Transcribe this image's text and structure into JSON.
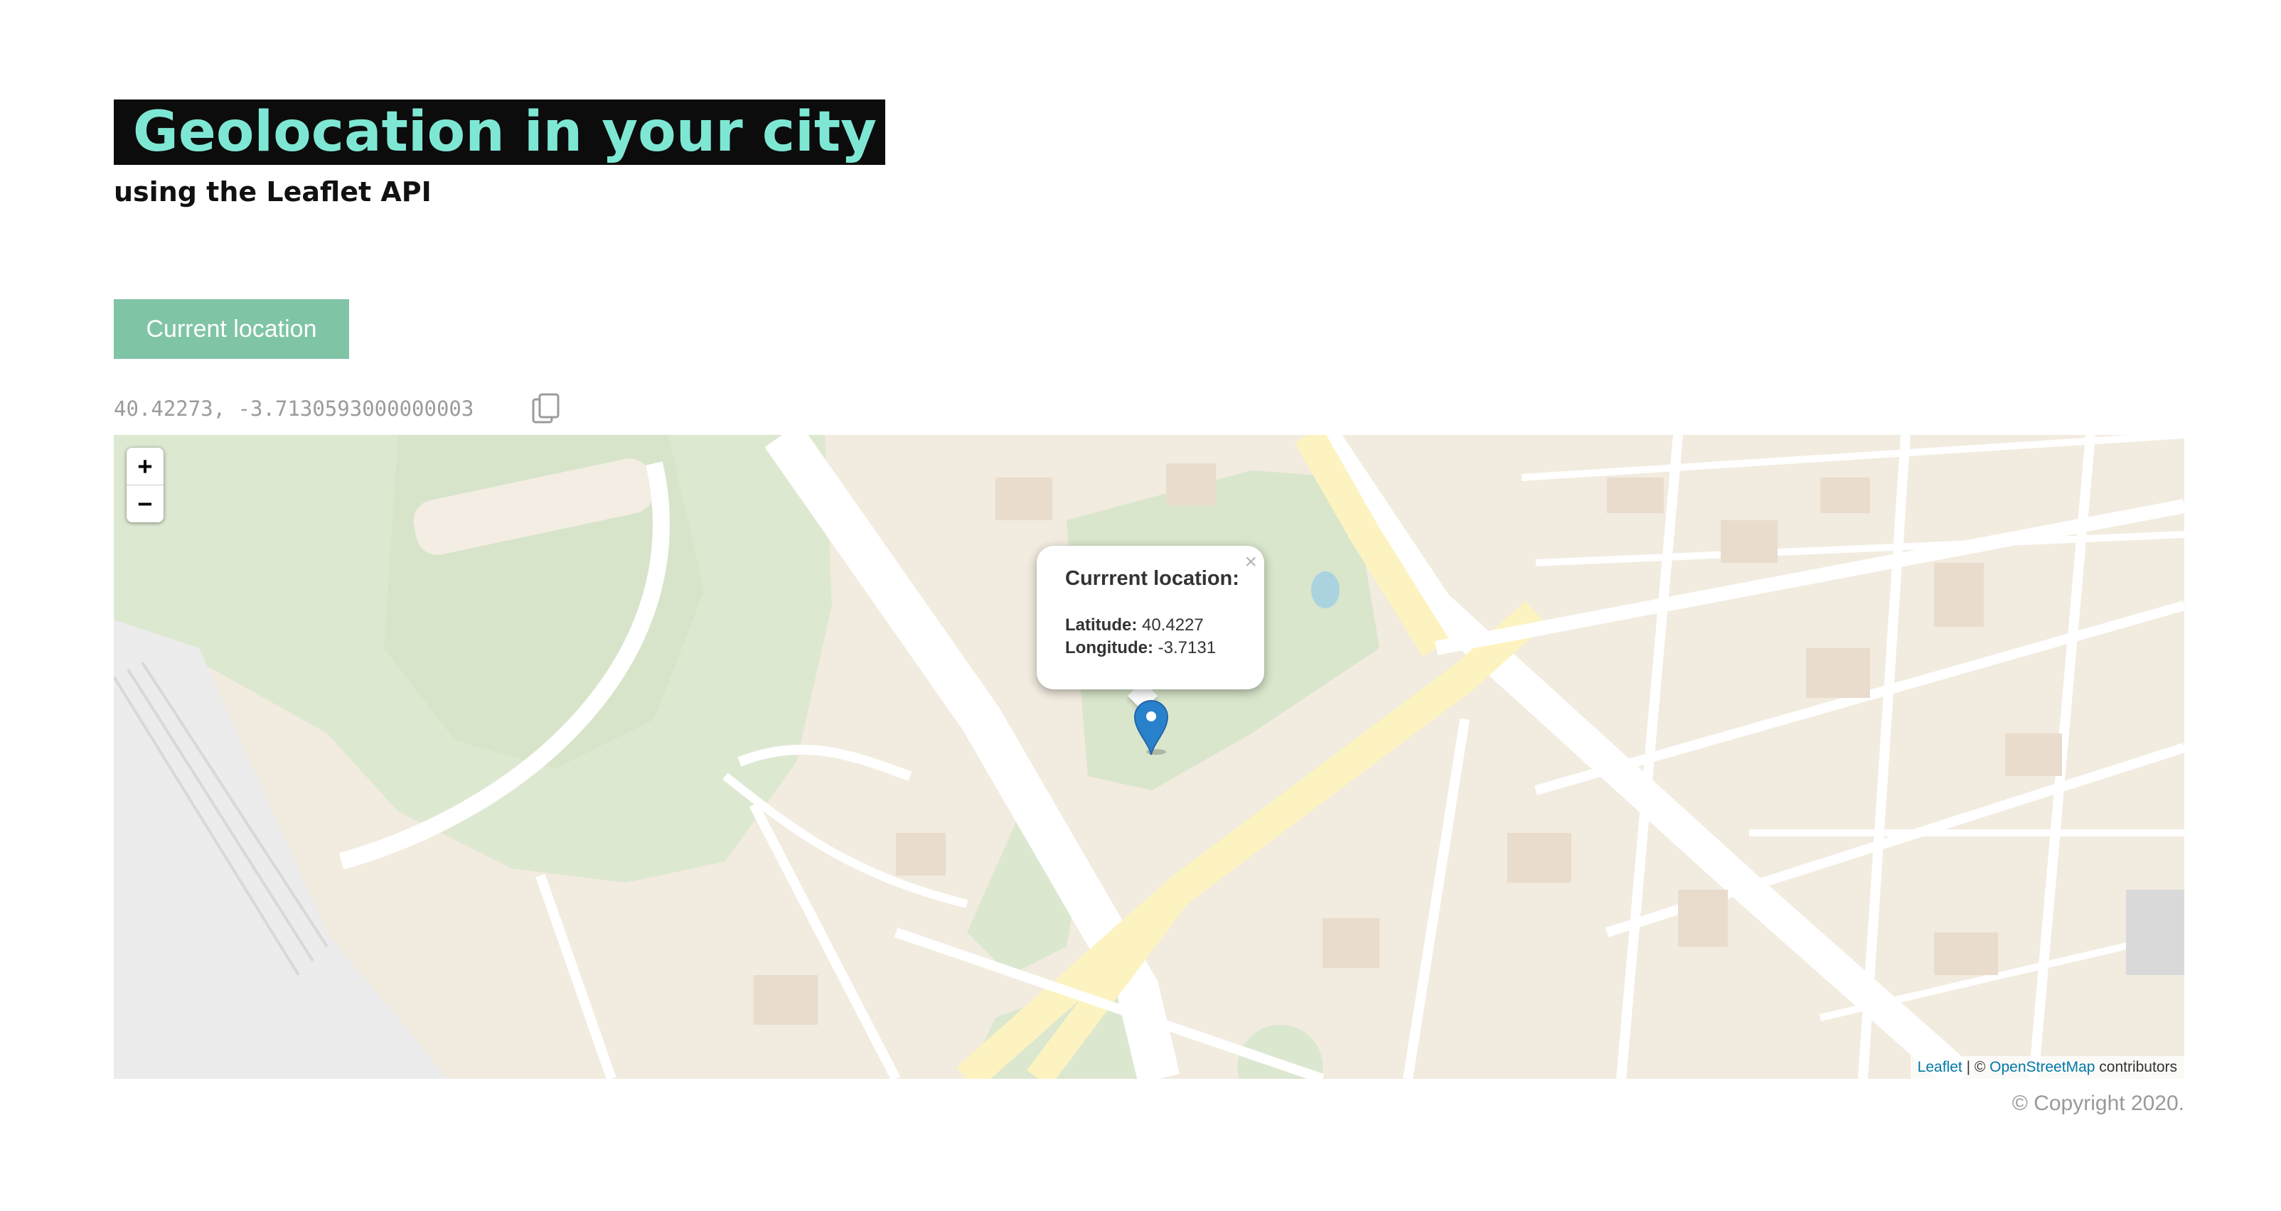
{
  "header": {
    "title": "Geolocation in your city",
    "subtitle": "using the Leaflet API"
  },
  "controls": {
    "current_location_button": "Current location",
    "coordinates_text": "40.42273, -3.7130593000000003",
    "copy_icon": "copy-icon"
  },
  "map": {
    "zoom_in": "+",
    "zoom_out": "−",
    "popup": {
      "title": "Currrent location:",
      "latitude_label": "Latitude:",
      "latitude_value": "40.4227",
      "longitude_label": "Longitude:",
      "longitude_value": "-3.7131",
      "close": "×"
    },
    "attribution": {
      "leaflet_link": "Leaflet",
      "separator": "| ©",
      "osm_link": "OpenStreetMap",
      "suffix": "contributors"
    },
    "marker_icon": "map-pin-icon"
  },
  "footer": {
    "copyright": "© Copyright 2020."
  },
  "colors": {
    "title_bg": "#0c0c0c",
    "title_text": "#7ee7d4",
    "button_bg": "#80c4a6",
    "marker": "#2a81cb"
  }
}
